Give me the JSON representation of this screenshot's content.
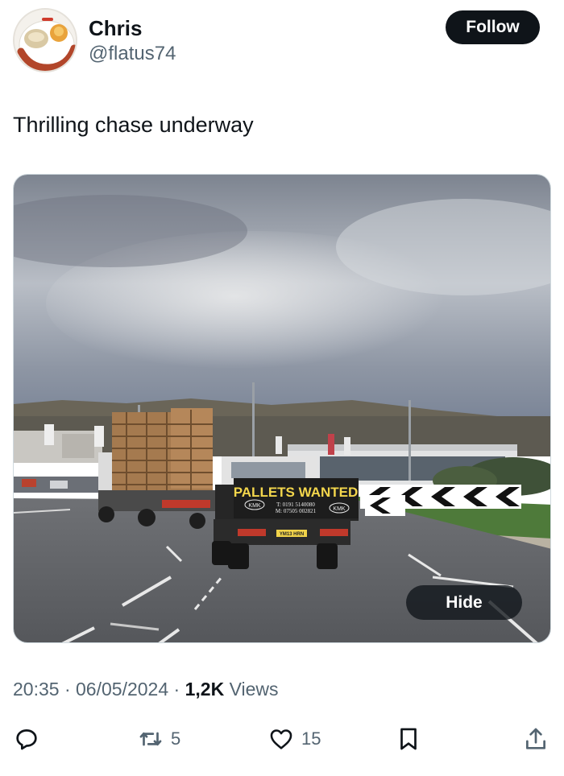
{
  "user": {
    "name": "Chris",
    "handle": "@flatus74",
    "follow_label": "Follow"
  },
  "tweet": {
    "text": "Thrilling chase underway",
    "media": {
      "hide_label": "Hide",
      "sign_title": "PALLETS WANTED",
      "sign_phone1": "T: 0191 5140080",
      "sign_phone2": "M: 07505 002821",
      "sign_logo_left": "KMK",
      "sign_logo_right": "KMK",
      "plate": "YM13 HRN"
    }
  },
  "meta": {
    "time": "20:35",
    "sep1": "·",
    "date": "06/05/2024",
    "sep2": "·",
    "views_count": "1,2K",
    "views_label": "Views"
  },
  "actions": {
    "reply_icon": "reply-icon",
    "retweet_icon": "retweet-icon",
    "retweets": "5",
    "like_icon": "heart-icon",
    "likes": "15",
    "bookmark_icon": "bookmark-icon",
    "share_icon": "share-icon"
  },
  "colors": {
    "text": "#0f1419",
    "secondary": "#536471",
    "button": "#0f1419"
  }
}
